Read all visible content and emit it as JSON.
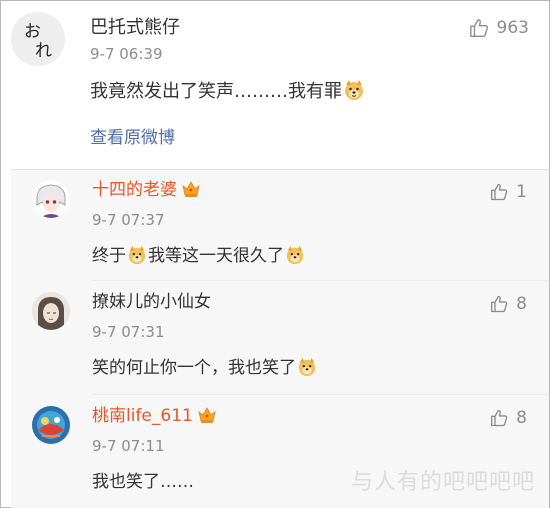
{
  "main_comment": {
    "avatar_text": "お\nれ",
    "username": "巴托式熊仔",
    "time": "9-7 06:39",
    "text_before_emoji": "我竟然发出了笑声………我有罪",
    "emoji": "doge-emoji",
    "view_original_label": "查看原微博",
    "like_count": "963",
    "colors": {
      "link": "#4e6ea7",
      "meta": "#8c8c8c",
      "text": "#333333"
    }
  },
  "replies": [
    {
      "username": "十四的老婆",
      "vip": true,
      "time": "9-7 07:37",
      "segments": [
        "终于",
        "doge-emoji",
        "我等这一天很久了",
        "doge-emoji"
      ],
      "text_parts": {
        "a": "终于",
        "b": "我等这一天很久了"
      },
      "like_count": "1"
    },
    {
      "username": "撩妹儿的小仙女",
      "vip": false,
      "time": "9-7 07:31",
      "text_parts": {
        "a": "笑的何止你一个，我也笑了"
      },
      "like_count": "8"
    },
    {
      "username": "桃南life_611",
      "vip": true,
      "time": "9-7 07:11",
      "text_parts": {
        "a": "我也笑了……"
      },
      "like_count": "8"
    }
  ],
  "watermark": "与人有的吧吧吧吧",
  "colors": {
    "vip_name": "#e8562a",
    "reply_bg": "#f7f7f7",
    "crown": "#f5a623"
  },
  "icons": [
    "thumbs-up-icon",
    "crown-icon",
    "doge-emoji"
  ]
}
